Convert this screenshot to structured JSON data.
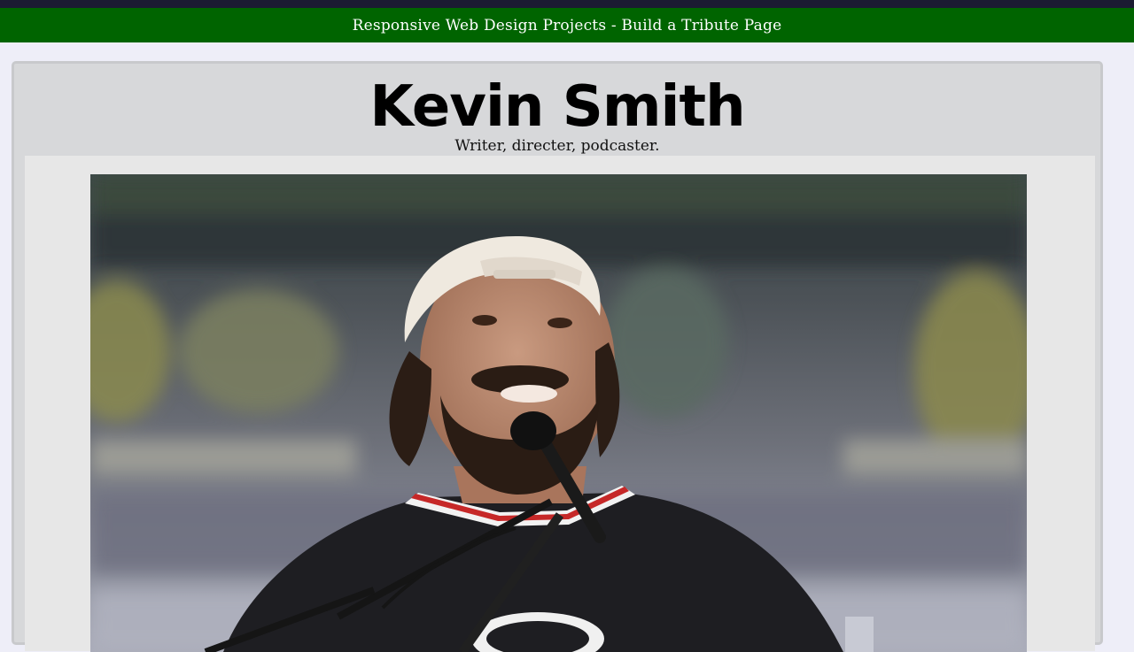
{
  "navbar": {
    "title": "Responsive Web Design Projects - Build a Tribute Page"
  },
  "tribute": {
    "title": "Kevin Smith",
    "subtitle": "Writer, directer, podcaster."
  },
  "image": {
    "subject": "photo of Kevin Smith at a microphone"
  }
}
